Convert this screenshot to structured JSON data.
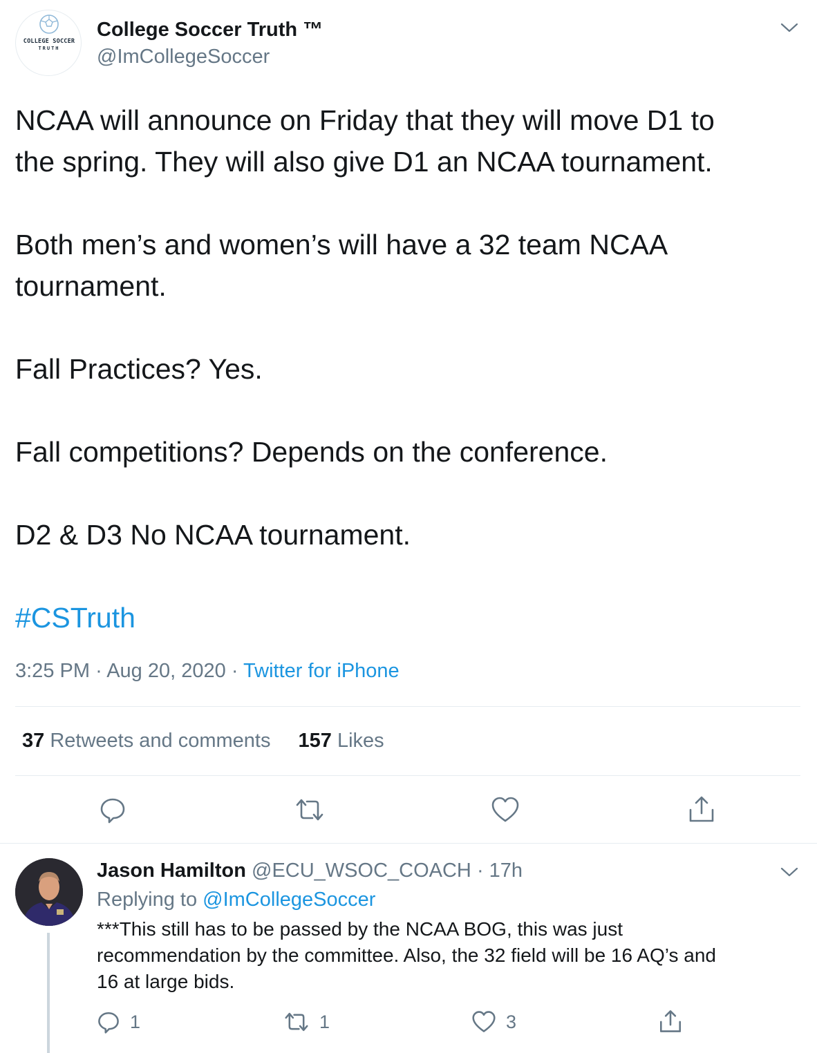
{
  "main_tweet": {
    "author": {
      "display_name": "College Soccer Truth ™",
      "handle": "@ImCollegeSoccer",
      "logo_line1": "COLLEGE SOCCER",
      "logo_line2": "TRUTH"
    },
    "paragraphs": [
      "NCAA will announce on Friday that they will move D1 to",
      "the spring. They will also give D1 an NCAA tournament.",
      "Both men’s and women’s will have a 32 team NCAA",
      "tournament.",
      "Fall Practices? Yes.",
      "Fall competitions? Depends on the conference.",
      "D2 & D3 No NCAA tournament."
    ],
    "hashtag": "#CSTruth",
    "time": "3:25 PM",
    "date": "Aug 20, 2020",
    "separator": "·",
    "source": "Twitter for iPhone",
    "stats": {
      "retweets_count": "37",
      "retweets_label": "Retweets and comments",
      "likes_count": "157",
      "likes_label": "Likes"
    }
  },
  "reply": {
    "display_name": "Jason Hamilton",
    "handle": "@ECU_WSOC_COACH",
    "separator": "·",
    "age": "17h",
    "replying_prefix": "Replying to",
    "replying_to": "@ImCollegeSoccer",
    "text_lines": [
      "***This still has to be passed by the NCAA BOG, this was just",
      "recommendation by the committee. Also, the 32 field will be 16 AQ’s and",
      "16 at large bids."
    ],
    "counts": {
      "comments": "1",
      "retweets": "1",
      "likes": "3"
    }
  },
  "colors": {
    "link": "#1b95e0",
    "secondary_text": "#657786",
    "primary_text": "#14171a",
    "divider": "#e6ecf0"
  },
  "icons": [
    "chevron-down-icon",
    "comment-icon",
    "retweet-icon",
    "like-icon",
    "share-icon"
  ]
}
